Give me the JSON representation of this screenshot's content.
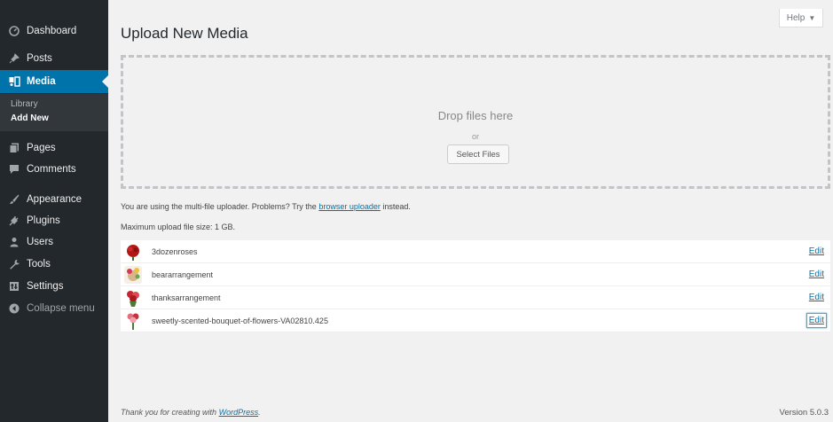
{
  "sidebar": {
    "items": [
      {
        "label": "Dashboard",
        "icon": "dashboard-icon"
      },
      {
        "label": "Posts",
        "icon": "pin-icon"
      },
      {
        "label": "Media",
        "icon": "media-icon"
      },
      {
        "label": "Pages",
        "icon": "pages-icon"
      },
      {
        "label": "Comments",
        "icon": "comment-icon"
      },
      {
        "label": "Appearance",
        "icon": "brush-icon"
      },
      {
        "label": "Plugins",
        "icon": "plug-icon"
      },
      {
        "label": "Users",
        "icon": "user-icon"
      },
      {
        "label": "Tools",
        "icon": "wrench-icon"
      },
      {
        "label": "Settings",
        "icon": "settings-icon"
      },
      {
        "label": "Collapse menu",
        "icon": "collapse-icon"
      }
    ],
    "submenu": [
      {
        "label": "Library"
      },
      {
        "label": "Add New"
      }
    ]
  },
  "header": {
    "help_label": "Help"
  },
  "main": {
    "title": "Upload New Media",
    "drop_zone": {
      "drop_text": "Drop files here",
      "or_text": "or",
      "select_label": "Select Files"
    },
    "uploader_info": {
      "prefix": "You are using the multi-file uploader. Problems? Try the",
      "link": "browser uploader",
      "suffix": "instead."
    },
    "max_size": "Maximum upload file size: 1 GB.",
    "media_items": [
      {
        "filename": "3dozenroses",
        "edit": "Edit"
      },
      {
        "filename": "beararrangement",
        "edit": "Edit"
      },
      {
        "filename": "thanksarrangement",
        "edit": "Edit"
      },
      {
        "filename": "sweetly-scented-bouquet-of-flowers-VA02810.425",
        "edit": "Edit"
      }
    ]
  },
  "footer": {
    "thanks_prefix": "Thank you for creating with",
    "thanks_link": "WordPress",
    "thanks_suffix": ".",
    "version": "Version 5.0.3"
  },
  "colors": {
    "sidebar_bg": "#23282d",
    "active": "#0073aa",
    "link": "#0073aa"
  }
}
